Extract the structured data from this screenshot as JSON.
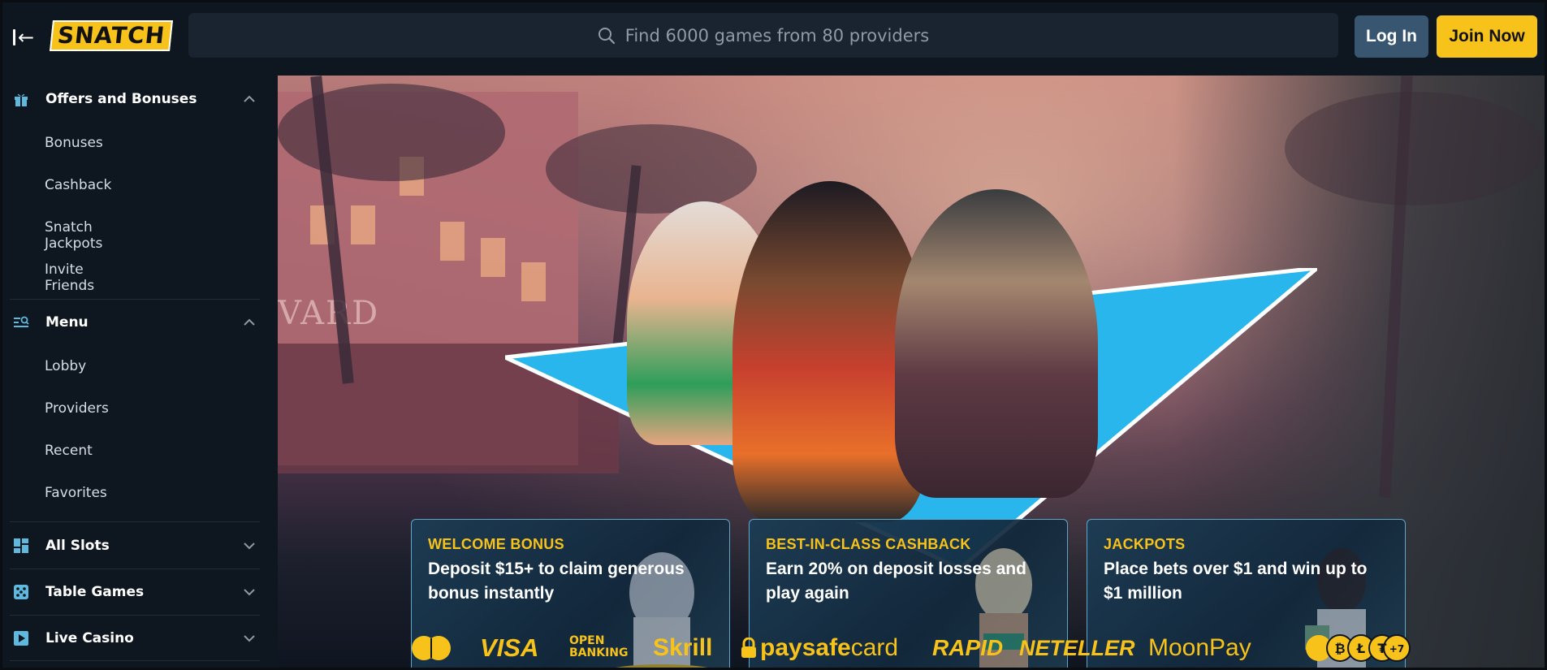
{
  "header": {
    "logo_text": "SNATCH",
    "search_placeholder": "Find 6000 games from 80 providers",
    "login_label": "Log In",
    "join_label": "Join Now"
  },
  "sidebar": {
    "groups": [
      {
        "title": "Offers and Bonuses",
        "icon": "gift-icon",
        "expanded": true,
        "items": [
          "Bonuses",
          "Cashback",
          "Snatch Jackpots",
          "Invite Friends"
        ]
      },
      {
        "title": "Menu",
        "icon": "menu-search-icon",
        "expanded": true,
        "items": [
          "Lobby",
          "Providers",
          "Recent",
          "Favorites"
        ]
      },
      {
        "title": "All Slots",
        "icon": "grid-icon",
        "expanded": false
      },
      {
        "title": "Table Games",
        "icon": "dice-icon",
        "expanded": false
      },
      {
        "title": "Live Casino",
        "icon": "play-icon",
        "expanded": false
      }
    ]
  },
  "hero": {
    "sign_text": "VARD",
    "cards": [
      {
        "title": "WELCOME BONUS",
        "text": "Deposit $15+ to claim generous bonus instantly"
      },
      {
        "title": "BEST-IN-CLASS CASHBACK",
        "text": "Earn 20% on deposit losses and play again"
      },
      {
        "title": "JACKPOTS",
        "text": "Place bets over $1 and win up to $1 million"
      }
    ]
  },
  "payments": {
    "visa": "VISA",
    "open_banking_1": "OPEN",
    "open_banking_2": "BANKING",
    "skrill": "Skrill",
    "paysafe_1": "paysafe",
    "paysafe_2": "card",
    "rapid": "RAPID",
    "neteller": "NETELLER",
    "moonpay": "MoonPay",
    "more_count": "+7"
  },
  "colors": {
    "accent": "#f7c21a",
    "login_bg": "#38566f",
    "bg": "#0e161f",
    "card_border": "#5ea6c9",
    "triangle": "#28b6ec"
  }
}
